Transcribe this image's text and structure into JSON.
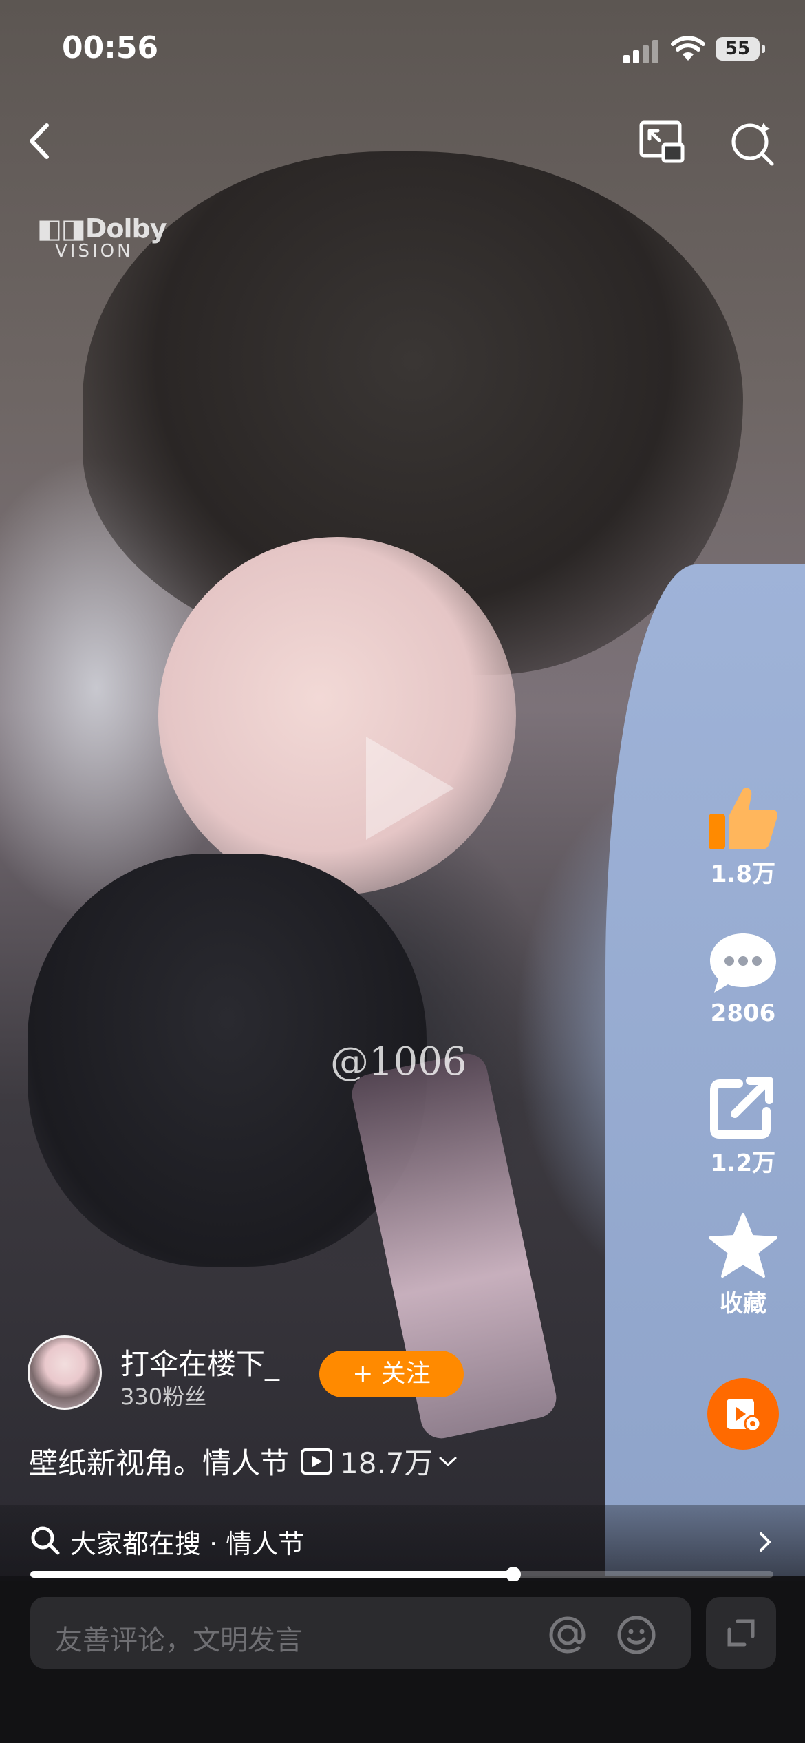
{
  "status_bar": {
    "time": "00:56",
    "battery": "55"
  },
  "video": {
    "watermark": "@1006",
    "badge_brand": "Dolby",
    "badge_sub": "VISION"
  },
  "actions": {
    "like_count": "1.8万",
    "comment_count": "2806",
    "share_count": "1.2万",
    "favorite_label": "收藏"
  },
  "author": {
    "name": "打伞在楼下_",
    "fans": "330粉丝",
    "follow_label": "+ 关注"
  },
  "caption": {
    "text": "壁纸新视角。情人节",
    "views": "18.7万"
  },
  "search": {
    "text": "大家都在搜 · 情人节"
  },
  "progress": {
    "fraction": 0.65
  },
  "comment": {
    "placeholder": "友善评论，文明发言"
  },
  "colors": {
    "accent_orange": "#ff8a00",
    "fab_orange": "#ff6a00",
    "like_orange": "#ff8a00"
  }
}
